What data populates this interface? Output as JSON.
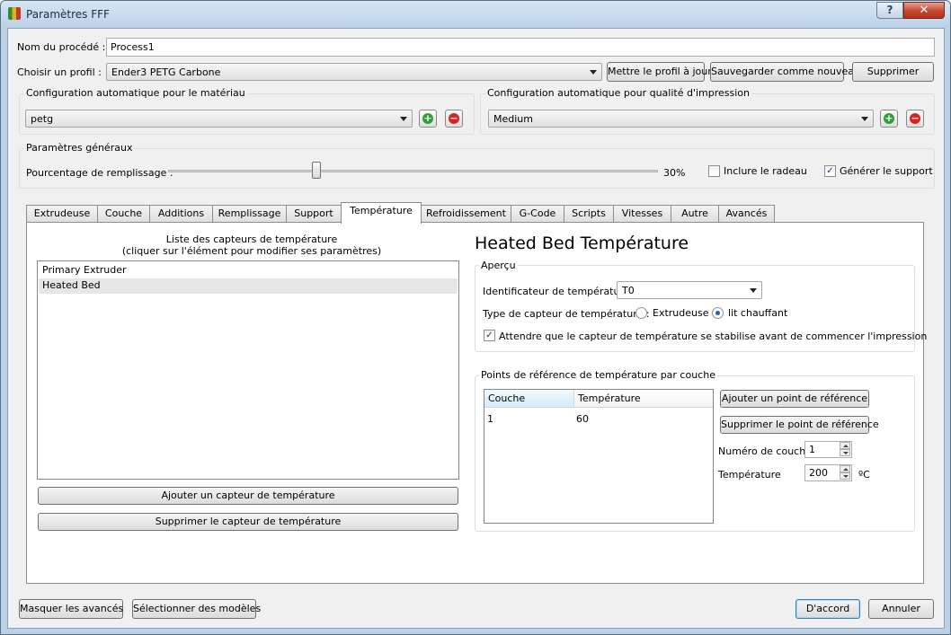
{
  "window": {
    "title": "Paramètres FFF",
    "help": "?",
    "close": "✕"
  },
  "process": {
    "name_label": "Nom du procédé :",
    "name_value": "Process1"
  },
  "profile": {
    "label": "Choisir un profil :",
    "selected": "Ender3 PETG Carbone",
    "update_btn": "Mettre le profil à jour",
    "save_new_btn": "Sauvegarder comme nouveau",
    "delete_btn": "Supprimer"
  },
  "auto_material": {
    "title": "Configuration automatique pour le matériau",
    "selected": "petg"
  },
  "auto_quality": {
    "title": "Configuration automatique pour qualité d'impression",
    "selected": "Medium"
  },
  "general": {
    "title": "Paramètres généraux",
    "infill_label": "Pourcentage de remplissage :",
    "infill_value": "30%",
    "infill_fraction": 0.3,
    "raft_label": "Inclure le radeau",
    "raft_checked": false,
    "support_label": "Générer le support",
    "support_checked": true
  },
  "tabs": [
    "Extrudeuse",
    "Couche",
    "Additions",
    "Remplissage",
    "Support",
    "Température",
    "Refroidissement",
    "G-Code",
    "Scripts",
    "Vitesses",
    "Autre",
    "Avancés"
  ],
  "active_tab": "Température",
  "sensors": {
    "list_title_1": "Liste des capteurs de température",
    "list_title_2": "(cliquer sur l'élément pour modifier ses paramètres)",
    "items": [
      "Primary Extruder",
      "Heated Bed"
    ],
    "selected": "Heated Bed",
    "add_btn": "Ajouter un capteur de température",
    "remove_btn": "Supprimer le capteur de température"
  },
  "detail": {
    "heading": "Heated Bed Température",
    "overview_title": "Aperçu",
    "id_label": "Identificateur de température",
    "id_value": "T0",
    "type_label": "Type de capteur de température :",
    "type_extruder": "Extrudeuse",
    "type_bed": "lit chauffant",
    "type_selected": "lit chauffant",
    "wait_label": "Attendre que le capteur de température se stabilise avant de commencer l'impression",
    "wait_checked": true,
    "points_title": "Points de référence de température par couche",
    "col_layer": "Couche",
    "col_temp": "Température",
    "rows": [
      {
        "layer": "1",
        "temp": "60"
      }
    ],
    "add_point_btn": "Ajouter un point de référence",
    "remove_point_btn": "Supprimer le point de référence",
    "layer_num_label": "Numéro de couche",
    "layer_num_value": "1",
    "temp_label": "Température",
    "temp_value": "200",
    "temp_unit": "ºC"
  },
  "footer": {
    "hide_adv": "Masquer les avancés",
    "select_models": "Sélectionner des modèles",
    "ok": "D'accord",
    "cancel": "Annuler"
  }
}
